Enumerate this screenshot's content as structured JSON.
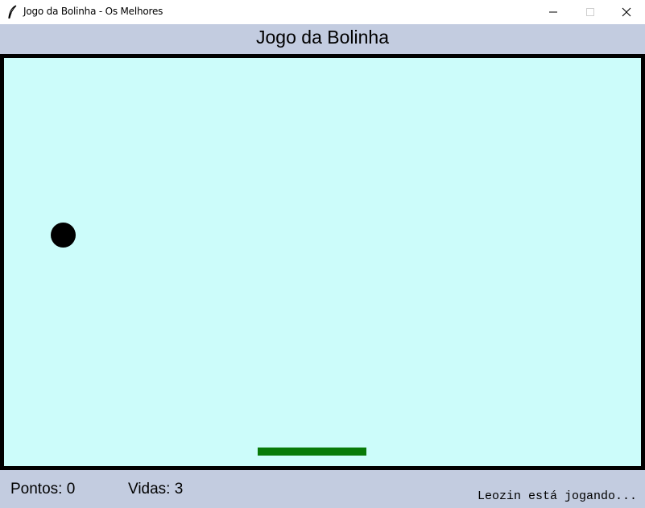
{
  "window": {
    "title": "Jogo da Bolinha - Os Melhores",
    "icon": "feather-icon",
    "controls": [
      "minimize-icon",
      "maximize-icon",
      "close-icon"
    ]
  },
  "header": {
    "title": "Jogo da Bolinha"
  },
  "game": {
    "background_color": "#ccfcfa",
    "border_color": "#000000",
    "ball_color": "#000000",
    "paddle_color": "#087a08"
  },
  "footer": {
    "score_label": "Pontos: 0",
    "lives_label": "Vidas: 3",
    "status": "Leozin está jogando..."
  }
}
